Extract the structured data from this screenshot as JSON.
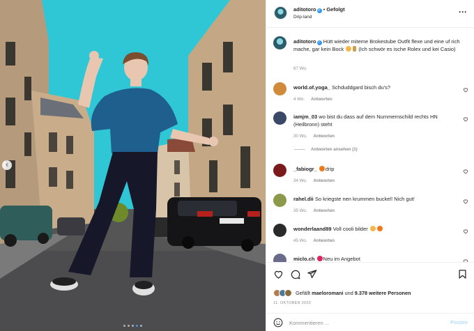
{
  "header": {
    "username": "aditotoro",
    "separator": "•",
    "follow_status": "Gefolgt",
    "location": "Drip-land",
    "more_icon": "more-horizontal-icon"
  },
  "caption": {
    "username": "aditotoro",
    "text": "Hütt wieder miteme Brokestube Outfit flexe und eine uf rich mache, gar kein Bock",
    "text_after_emoji": "(Ich schwör es ische Rolex und kei Casio)",
    "age": "67 Wo."
  },
  "comments": [
    {
      "username": "world.of.yoga_",
      "text": "Schduddgard bisch du's?",
      "age": "4 Wo.",
      "reply": "Antworten",
      "avatar_color": "#d08a3a"
    },
    {
      "username": "iamjm_03",
      "text": "wo bist du dass auf dem Nummernschild rechts HN (Heilbronn) steht",
      "age": "30 Wo.",
      "reply": "Antworten",
      "view_replies": "Antworten ansehen (1)",
      "avatar_color": "#3a4a66"
    },
    {
      "username": "_fabiogr_",
      "text": "drip",
      "age": "34 Wo.",
      "reply": "Antworten",
      "avatar_color": "#7a1a1a"
    },
    {
      "username": "rahel.dii",
      "text": "So kriegste nen krummen buckel! Nich gut!",
      "age": "35 Wo.",
      "reply": "Antworten",
      "avatar_color": "#8a9a4a"
    },
    {
      "username": "wonderlaand89",
      "text": "Voll cooli bilder",
      "age": "45 Wo.",
      "reply": "Antworten",
      "avatar_color": "#2a2a2a"
    },
    {
      "username": "miclo.ch",
      "text": "Neu im Angebot",
      "age": "",
      "reply": "",
      "avatar_color": "#6a6a8a"
    }
  ],
  "actions": {
    "likes_prefix": "Gefällt",
    "likes_user": "maeloromani",
    "likes_mid": "und",
    "likes_count": "9.378 weitere Personen",
    "date": "11. OKTOBER 2020"
  },
  "comment_box": {
    "placeholder": "Kommentieren ...",
    "post_label": "Posten"
  },
  "carousel": {
    "total": 5,
    "active_index": 4
  },
  "colors": {
    "accent": "#3897f0",
    "secondary_text": "#8e8e8e",
    "sky": "#2fc6d6"
  }
}
